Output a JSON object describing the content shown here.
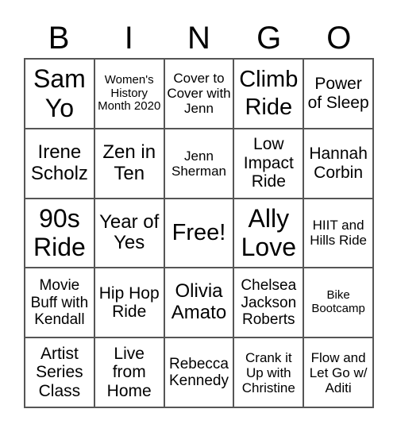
{
  "header": {
    "letters": [
      "B",
      "I",
      "N",
      "G",
      "O"
    ]
  },
  "grid": {
    "rows": [
      [
        "Sam Yo",
        "Women's History Month 2020",
        "Cover to Cover with Jenn",
        "Climb Ride",
        "Power of Sleep"
      ],
      [
        "Irene Scholz",
        "Zen in Ten",
        "Jenn Sherman",
        "Low Impact Ride",
        "Hannah Corbin"
      ],
      [
        "90s Ride",
        "Year of Yes",
        "Free!",
        "Ally Love",
        "HIIT and Hills Ride"
      ],
      [
        "Movie Buff with Kendall",
        "Hip Hop Ride",
        "Olivia Amato",
        "Chelsea Jackson Roberts",
        "Bike Bootcamp"
      ],
      [
        "Artist Series Class",
        "Live from Home",
        "Rebecca Kennedy",
        "Crank it Up with Christine",
        "Flow and Let Go w/ Aditi"
      ]
    ]
  }
}
